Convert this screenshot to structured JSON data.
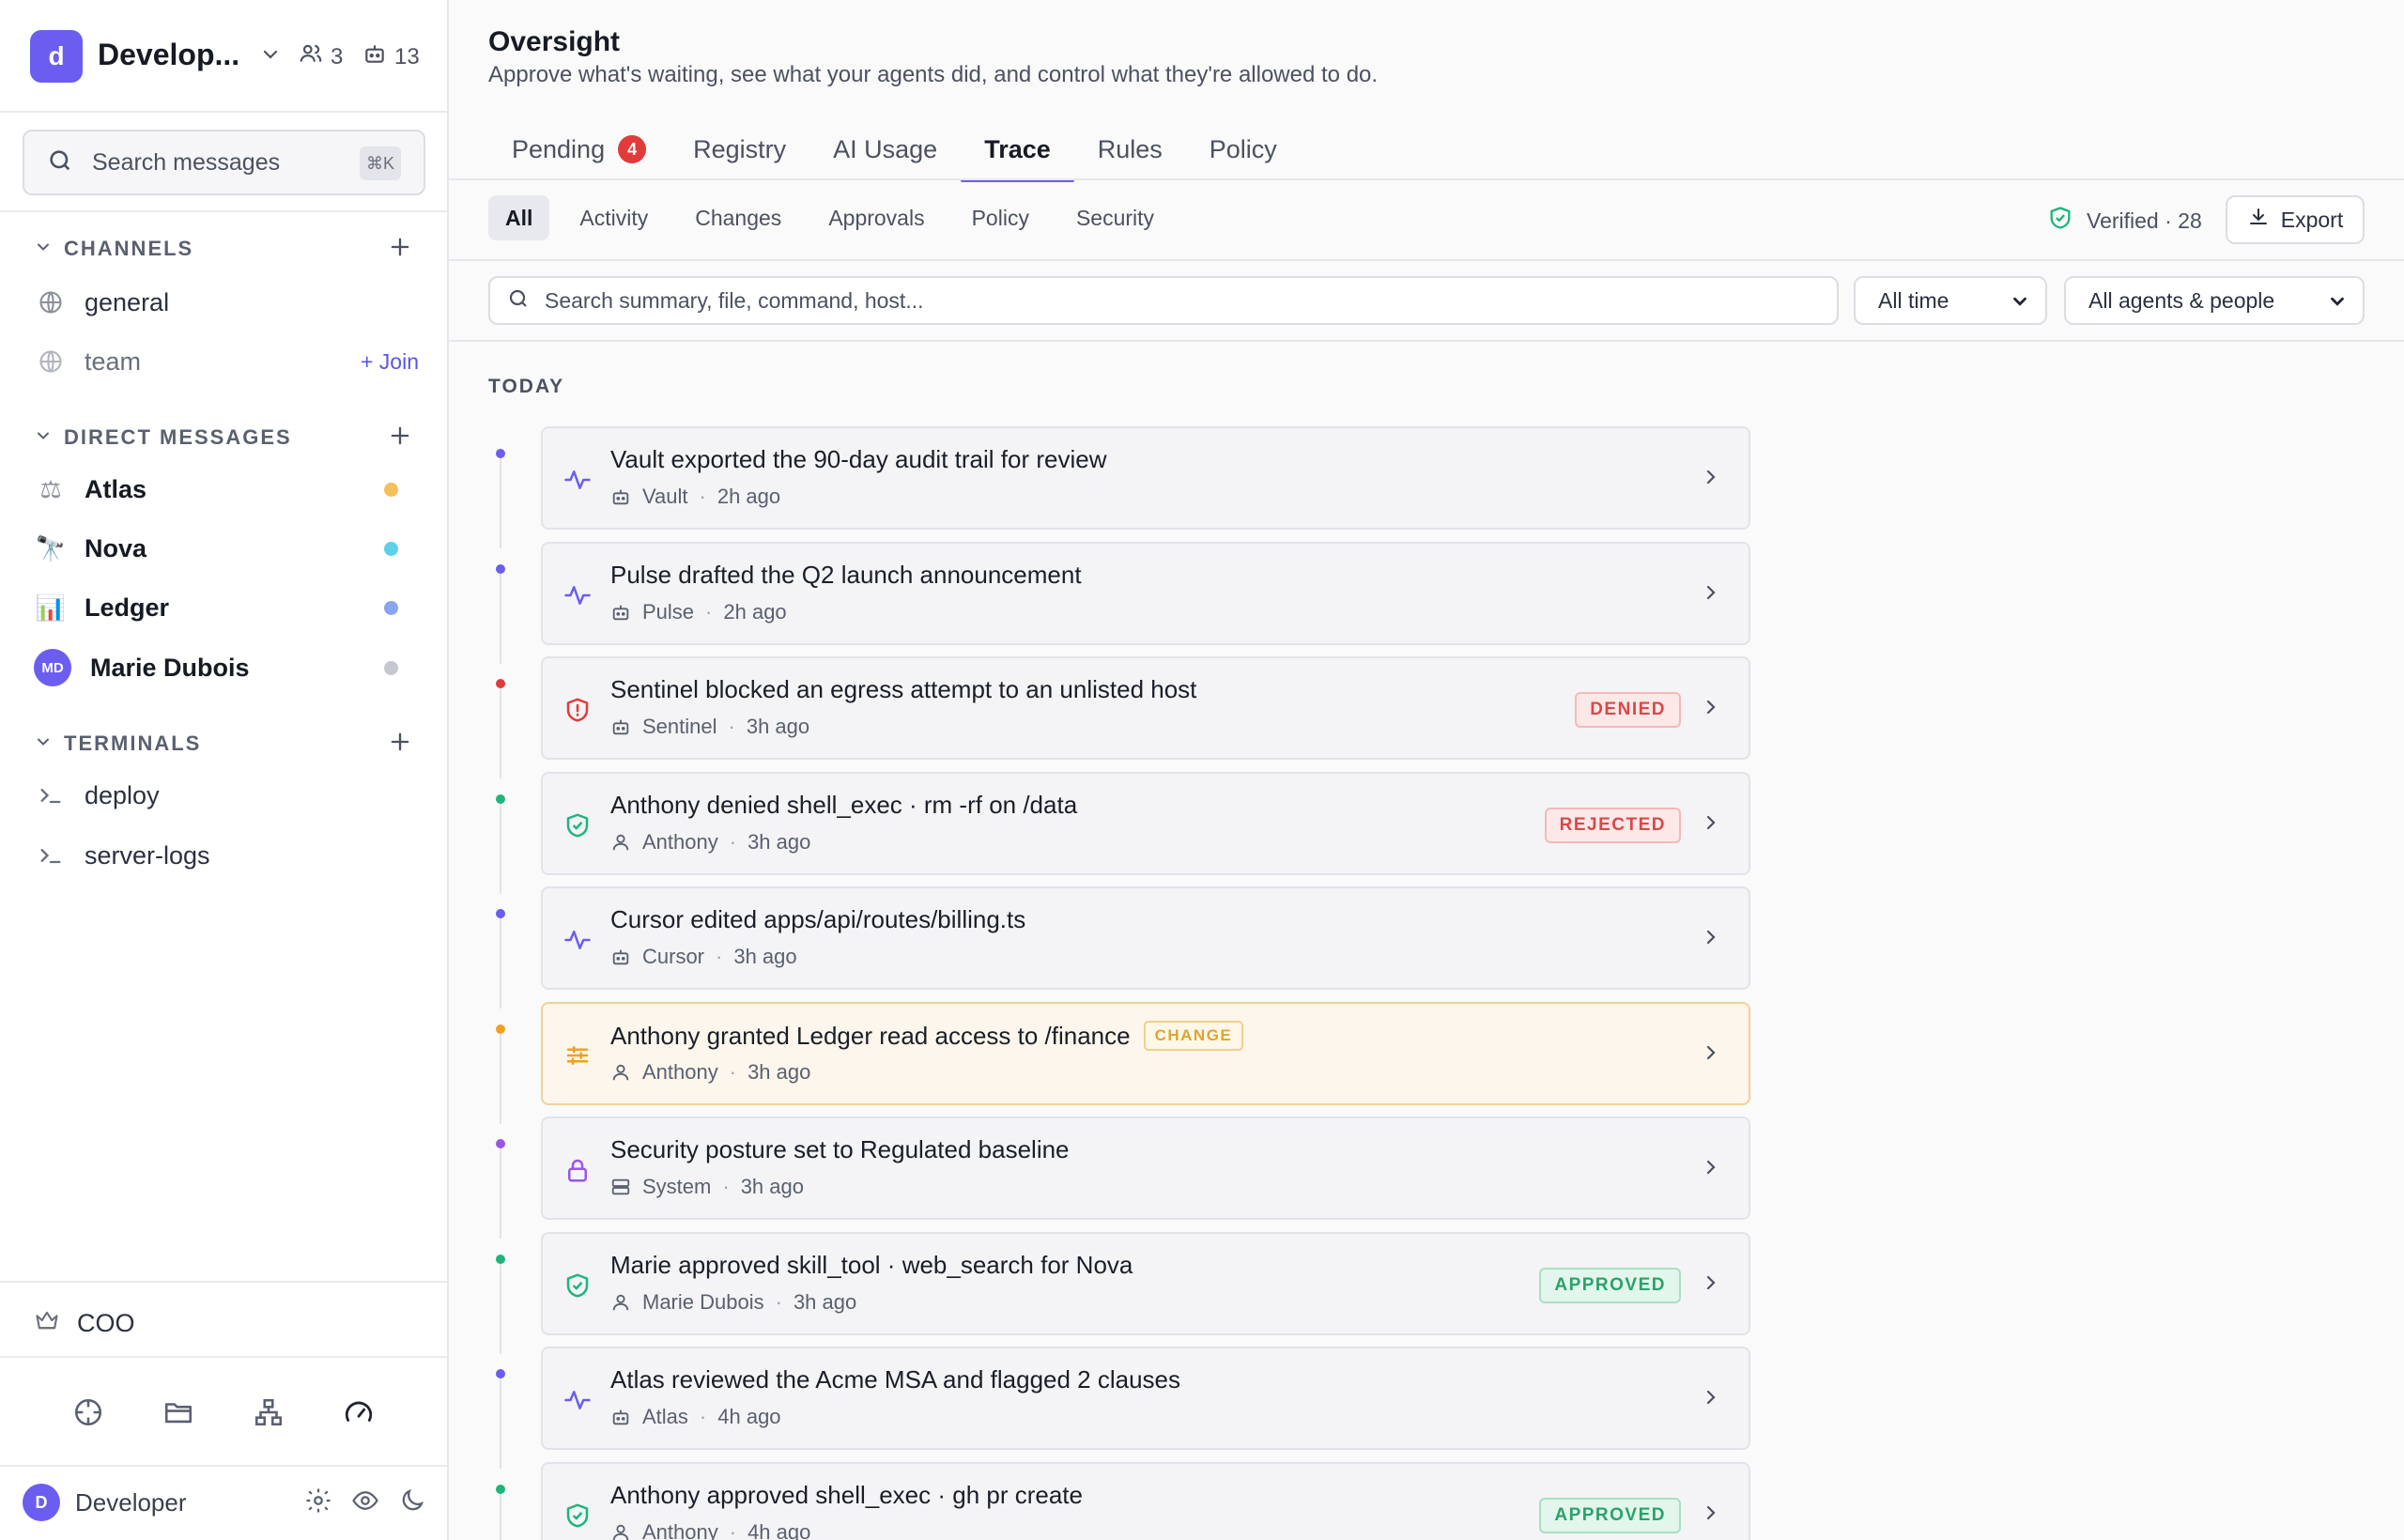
{
  "workspace": {
    "initial": "d",
    "name": "Develop...",
    "members": "3",
    "agents": "13"
  },
  "sidebar": {
    "search_placeholder": "Search messages",
    "search_shortcut": "⌘K",
    "channels_label": "CHANNELS",
    "channels": [
      {
        "name": "general"
      },
      {
        "name": "team",
        "action": "+ Join"
      }
    ],
    "dm_label": "DIRECT MESSAGES",
    "dms": [
      {
        "name": "Atlas",
        "glyph": "⚖",
        "status_color": "#f5c05b"
      },
      {
        "name": "Nova",
        "glyph": "🔭",
        "status_color": "#5ccfe9"
      },
      {
        "name": "Ledger",
        "glyph": "📊",
        "status_color": "#8aa4f0"
      },
      {
        "name": "Marie Dubois",
        "initials": "MD",
        "status_color": "#c6c8cf"
      }
    ],
    "terminals_label": "TERMINALS",
    "terminals": [
      {
        "name": "deploy"
      },
      {
        "name": "server-logs"
      }
    ],
    "role": "COO",
    "user": {
      "initial": "D",
      "name": "Developer"
    }
  },
  "header": {
    "title": "Oversight",
    "subtitle": "Approve what's waiting, see what your agents did, and control what they're allowed to do."
  },
  "tabs": [
    {
      "label": "Pending",
      "badge": "4"
    },
    {
      "label": "Registry"
    },
    {
      "label": "AI Usage"
    },
    {
      "label": "Trace",
      "active": true
    },
    {
      "label": "Rules"
    },
    {
      "label": "Policy"
    }
  ],
  "filters": [
    "All",
    "Activity",
    "Changes",
    "Approvals",
    "Policy",
    "Security"
  ],
  "verified": "Verified · 28",
  "export_label": "Export",
  "trace_search_placeholder": "Search summary, file, command, host...",
  "time_select": "All time",
  "agent_select": "All agents & people",
  "section_label": "TODAY",
  "events": [
    {
      "title": "Vault exported the 90-day audit trail for review",
      "actor": "Vault",
      "actor_type": "agent",
      "time": "2h ago",
      "icon": "activity-icon",
      "dot": "#6a5df0"
    },
    {
      "title": "Pulse drafted the Q2 launch announcement",
      "actor": "Pulse",
      "actor_type": "agent",
      "time": "2h ago",
      "icon": "activity-icon",
      "dot": "#6a5df0"
    },
    {
      "title": "Sentinel blocked an egress attempt to an unlisted host",
      "actor": "Sentinel",
      "actor_type": "agent",
      "time": "3h ago",
      "icon": "shield-alert-icon",
      "dot": "#e23b3b",
      "status": "DENIED"
    },
    {
      "title": "Anthony denied shell_exec · rm -rf on /data",
      "actor": "Anthony",
      "actor_type": "person",
      "time": "3h ago",
      "icon": "shield-check-icon",
      "dot": "#1fb57a",
      "status": "REJECTED"
    },
    {
      "title": "Cursor edited apps/api/routes/billing.ts",
      "actor": "Cursor",
      "actor_type": "agent",
      "time": "3h ago",
      "icon": "activity-icon",
      "dot": "#6a5df0"
    },
    {
      "title": "Anthony granted Ledger read access to /finance",
      "actor": "Anthony",
      "actor_type": "person",
      "time": "3h ago",
      "icon": "sliders-icon",
      "dot": "#f0a020",
      "tag": "CHANGE"
    },
    {
      "title": "Security posture set to Regulated baseline",
      "actor": "System",
      "actor_type": "system",
      "time": "3h ago",
      "icon": "lock-icon",
      "dot": "#9a55e8"
    },
    {
      "title": "Marie approved skill_tool · web_search for Nova",
      "actor": "Marie Dubois",
      "actor_type": "person",
      "time": "3h ago",
      "icon": "shield-check-icon",
      "dot": "#1fb57a",
      "status": "APPROVED"
    },
    {
      "title": "Atlas reviewed the Acme MSA and flagged 2 clauses",
      "actor": "Atlas",
      "actor_type": "agent",
      "time": "4h ago",
      "icon": "activity-icon",
      "dot": "#6a5df0"
    },
    {
      "title": "Anthony approved shell_exec · gh pr create",
      "actor": "Anthony",
      "actor_type": "person",
      "time": "4h ago",
      "icon": "shield-check-icon",
      "dot": "#1fb57a",
      "status": "APPROVED"
    }
  ]
}
